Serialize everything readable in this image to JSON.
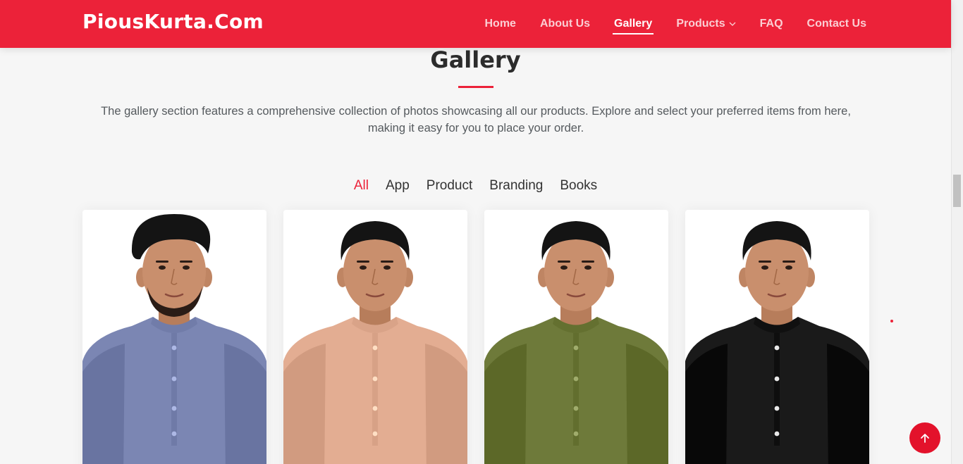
{
  "brand": {
    "logo": "PiousKurta.Com",
    "accent": "#ec2239"
  },
  "nav": {
    "items": [
      {
        "label": "Home"
      },
      {
        "label": "About Us"
      },
      {
        "label": "Gallery"
      },
      {
        "label": "Products"
      },
      {
        "label": "FAQ"
      },
      {
        "label": "Contact Us"
      }
    ],
    "active": "Gallery"
  },
  "gallery": {
    "title": "Gallery",
    "description": "The gallery section features a comprehensive collection of photos showcasing all our products. Explore and select your preferred items from here, making it easy for you to place your order.",
    "filters": [
      {
        "label": "All"
      },
      {
        "label": "App"
      },
      {
        "label": "Product"
      },
      {
        "label": "Branding"
      },
      {
        "label": "Books"
      }
    ],
    "active_filter": "All",
    "items": [
      {
        "kurta_color": "#7b86b3",
        "hair": "tall"
      },
      {
        "kurta_color": "#e3ad92",
        "hair": "short"
      },
      {
        "kurta_color": "#6e7a3a",
        "hair": "short"
      },
      {
        "kurta_color": "#1a1a1a",
        "hair": "short"
      }
    ]
  },
  "icons": {
    "back_to_top": "arrow-up-icon",
    "dropdown": "chevron-down-icon"
  }
}
